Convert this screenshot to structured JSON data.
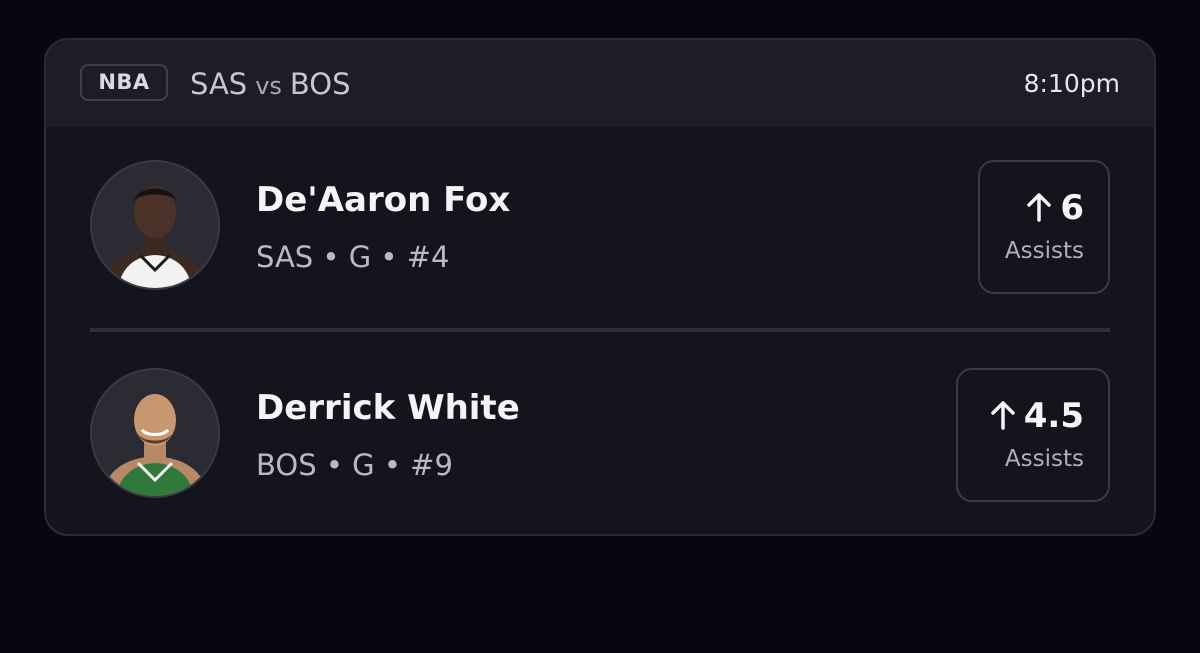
{
  "header": {
    "league": "NBA",
    "home_team": "SAS",
    "vs": "vs",
    "away_team": "BOS",
    "time": "8:10pm"
  },
  "players": [
    {
      "name": "De'Aaron Fox",
      "team": "SAS",
      "position": "G",
      "number": "#4",
      "meta": "SAS • G • #4",
      "direction_icon": "arrow-up-icon",
      "line": "6",
      "stat": "Assists",
      "jersey_color": "#f2f2f2"
    },
    {
      "name": "Derrick White",
      "team": "BOS",
      "position": "G",
      "number": "#9",
      "meta": "BOS • G • #9",
      "direction_icon": "arrow-up-icon",
      "line": "4.5",
      "stat": "Assists",
      "jersey_color": "#2f7a3b"
    }
  ]
}
